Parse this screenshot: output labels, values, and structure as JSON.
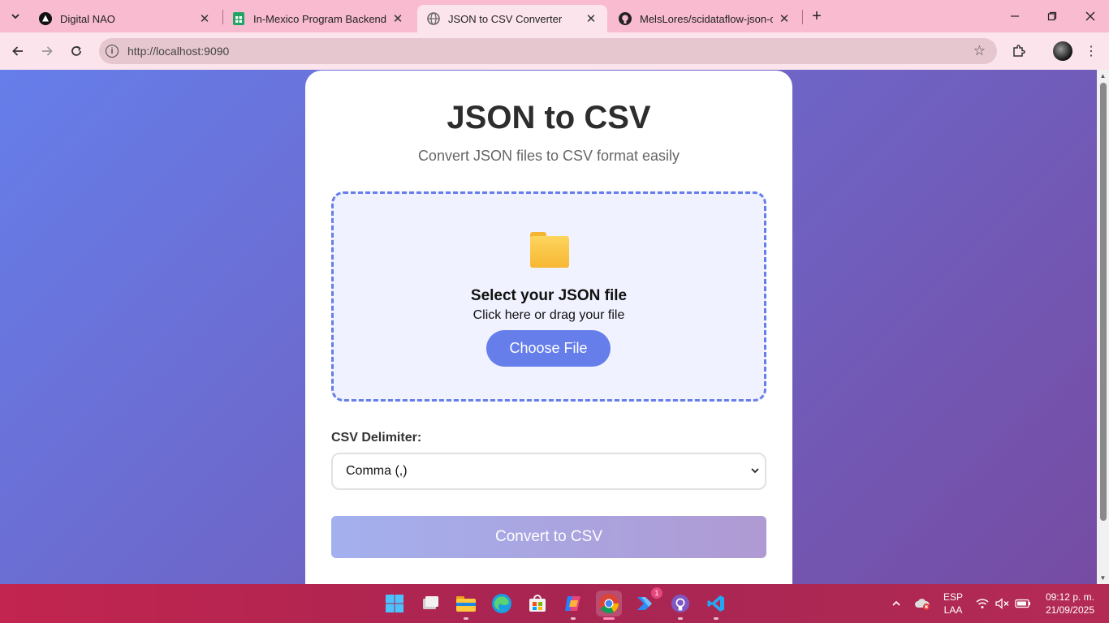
{
  "browser": {
    "tabs": [
      {
        "title": "Digital NAO",
        "icon": "triangle-logo-icon",
        "active": false
      },
      {
        "title": "In-Mexico Program Backend Gp",
        "icon": "sheets-icon",
        "active": false
      },
      {
        "title": "JSON to CSV Converter",
        "icon": "globe-icon",
        "active": true
      },
      {
        "title": "MelsLores/scidataflow-json-csv",
        "icon": "github-icon",
        "active": false
      }
    ],
    "url": "http://localhost:9090"
  },
  "page": {
    "title": "JSON to CSV",
    "subtitle": "Convert JSON files to CSV format easily",
    "dropzone": {
      "icon": "folder-icon",
      "title": "Select your JSON file",
      "hint": "Click here or drag your file",
      "button_label": "Choose File"
    },
    "delimiter": {
      "label": "CSV Delimiter:",
      "selected": "Comma (,)"
    },
    "convert_label": "Convert to CSV"
  },
  "taskbar": {
    "language_top": "ESP",
    "language_bottom": "LAA",
    "time": "09:12 p. m.",
    "date": "21/09/2025",
    "notification_count": "1"
  },
  "colors": {
    "gradient_start": "#667eea",
    "gradient_end": "#764ba2",
    "accent": "#667eea",
    "tabstrip": "#f8bbd0",
    "taskbar": "#b32a55"
  }
}
